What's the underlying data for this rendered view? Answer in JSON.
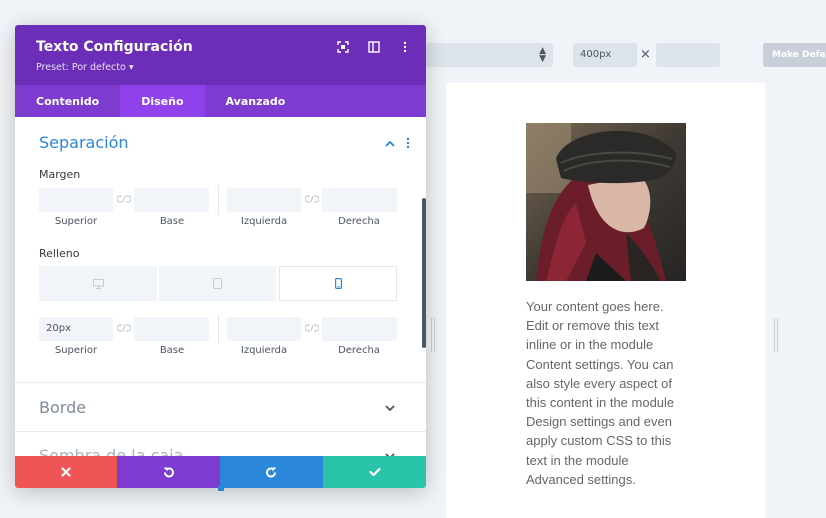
{
  "toolbar": {
    "width_value": "400px",
    "times_symbol": "×",
    "default_button": "Make Default"
  },
  "modal": {
    "title": "Texto Configuración",
    "preset": "Preset: Por defecto ▾",
    "tabs": [
      {
        "label": "Contenido"
      },
      {
        "label": "Diseño"
      },
      {
        "label": "Avanzado"
      }
    ],
    "active_tab": "Diseño"
  },
  "spacing": {
    "title": "Separación",
    "margin": {
      "label": "Margen",
      "top_value": "",
      "bottom_value": "",
      "left_value": "",
      "right_value": ""
    },
    "padding": {
      "label": "Relleno",
      "top_value": "20px",
      "bottom_value": "",
      "left_value": "",
      "right_value": ""
    },
    "sublabels": {
      "top": "Superior",
      "bottom": "Base",
      "left": "Izquierda",
      "right": "Derecha"
    }
  },
  "sections": {
    "border": "Borde",
    "box_shadow": "Sombra de la caja"
  },
  "preview": {
    "body_text": "Your content goes here. Edit or remove this text inline or in the module Content settings. You can also style every aspect of this content in the module Design settings and even apply custom CSS to this text in the module Advanced settings."
  },
  "colors": {
    "header": "#6c2eb9",
    "tabs": "#7e3bd0",
    "active_tab": "#8f42ec",
    "accent_blue": "#2b87da",
    "cancel": "#ef5555",
    "save": "#29c4a9"
  }
}
